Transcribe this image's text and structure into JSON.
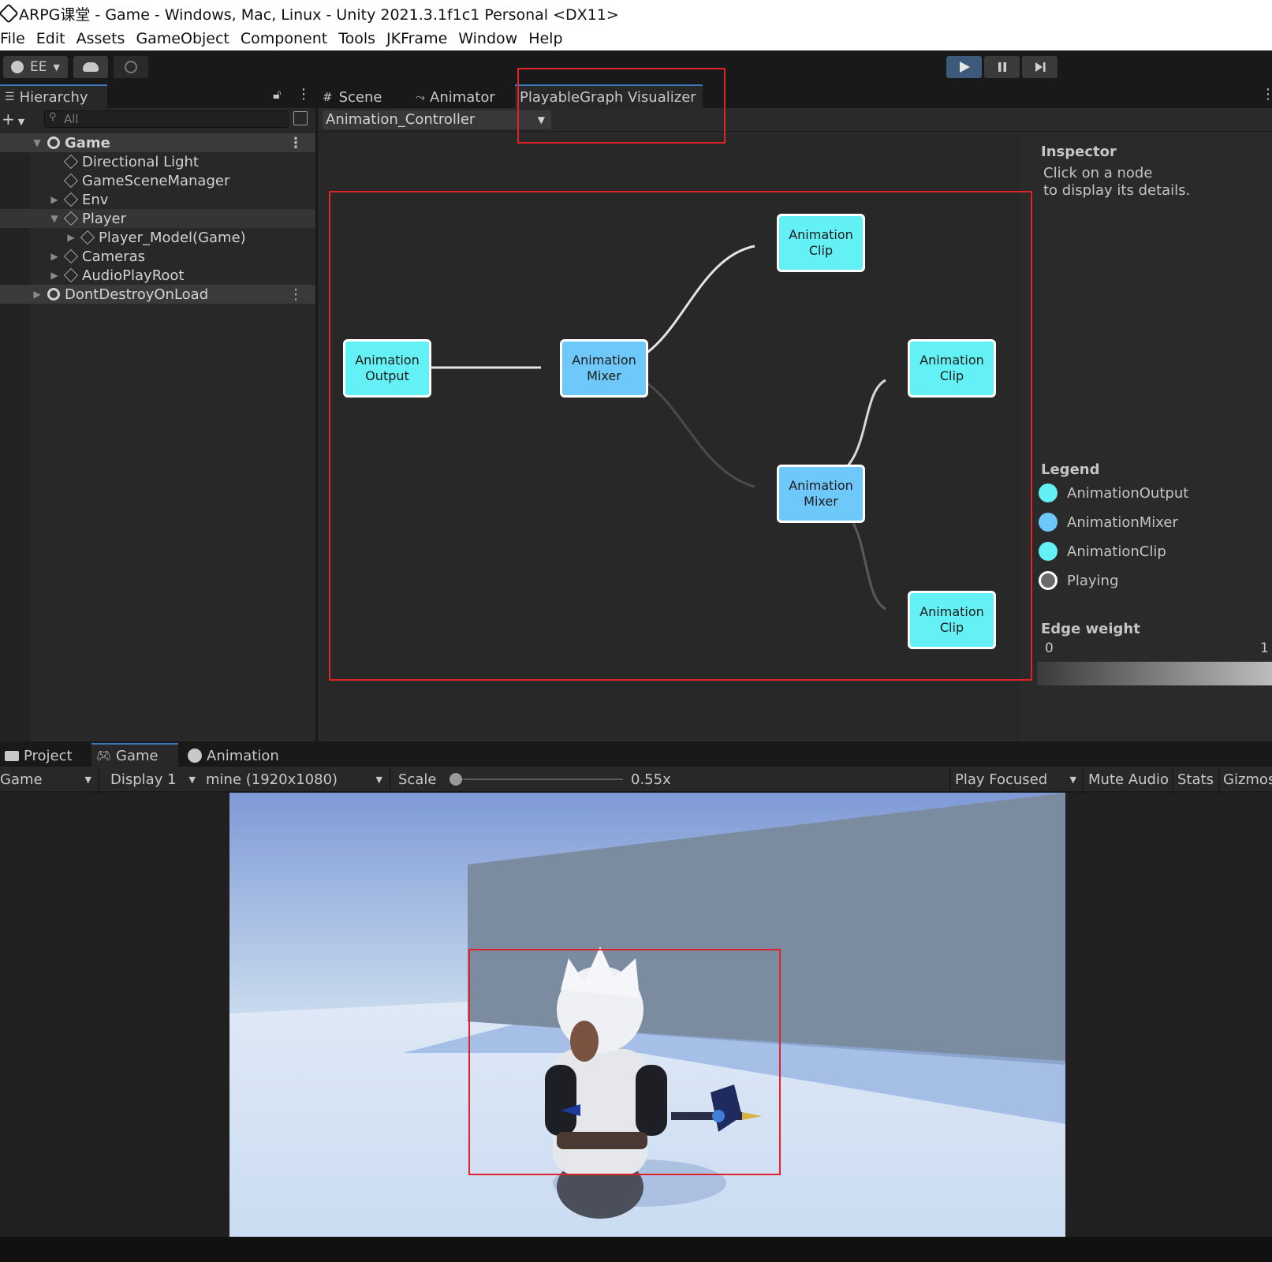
{
  "window": {
    "title": "ARPG课堂 - Game - Windows, Mac, Linux - Unity 2021.3.1f1c1 Personal <DX11>"
  },
  "menu": [
    "File",
    "Edit",
    "Assets",
    "GameObject",
    "Component",
    "Tools",
    "JKFrame",
    "Window",
    "Help"
  ],
  "toolbar": {
    "account_label": "EE",
    "icons": [
      "account-icon",
      "cloud-icon",
      "collab-icon",
      "play-icon",
      "pause-icon",
      "step-icon"
    ]
  },
  "hierarchy": {
    "tab_label": "Hierarchy",
    "search_placeholder": "All",
    "rows": [
      {
        "label": "Game"
      },
      {
        "label": "Directional Light"
      },
      {
        "label": "GameSceneManager"
      },
      {
        "label": "Env"
      },
      {
        "label": "Player"
      },
      {
        "label": "Player_Model(Game)"
      },
      {
        "label": "Cameras"
      },
      {
        "label": "AudioPlayRoot"
      },
      {
        "label": "DontDestroyOnLoad"
      }
    ]
  },
  "graph_panel": {
    "tabs": [
      {
        "label": "Scene"
      },
      {
        "label": "Animator"
      },
      {
        "label": "PlayableGraph Visualizer"
      }
    ],
    "selected_graph": "Animation_Controller",
    "nodes": [
      {
        "label": "Animation\nOutput",
        "type": "AnimationOutput"
      },
      {
        "label": "Animation\nMixer",
        "type": "AnimationMixer"
      },
      {
        "label": "Animation\nClip",
        "type": "AnimationClip"
      },
      {
        "label": "Animation\nClip",
        "type": "AnimationClip"
      },
      {
        "label": "Animation\nMixer",
        "type": "AnimationMixer"
      },
      {
        "label": "Animation\nClip",
        "type": "AnimationClip"
      }
    ],
    "colors": {
      "output": "#64f1f5",
      "mixer": "#6ec8f9",
      "clip": "#64f1f5",
      "playing": "#6b6b6b",
      "highlight": "#e0232a"
    }
  },
  "inspector": {
    "title": "Inspector",
    "hint_line1": "Click on a node",
    "hint_line2": "to display its details.",
    "legend_title": "Legend",
    "legend": [
      {
        "label": "AnimationOutput"
      },
      {
        "label": "AnimationMixer"
      },
      {
        "label": "AnimationClip"
      },
      {
        "label": "Playing"
      }
    ],
    "edge_weight_title": "Edge weight",
    "edge_min": "0",
    "edge_max": "1"
  },
  "bottom": {
    "tabs": [
      {
        "label": "Project"
      },
      {
        "label": "Game"
      },
      {
        "label": "Animation"
      }
    ],
    "game_toolbar": {
      "view_select": "Game",
      "display_select": "Display 1",
      "resolution_select": "mine (1920x1080)",
      "scale_label": "Scale",
      "scale_value": "0.55x",
      "scale_fraction": 0.0,
      "play_focused": "Play Focused",
      "mute_audio": "Mute Audio",
      "stats": "Stats",
      "gizmos": "Gizmos"
    }
  }
}
